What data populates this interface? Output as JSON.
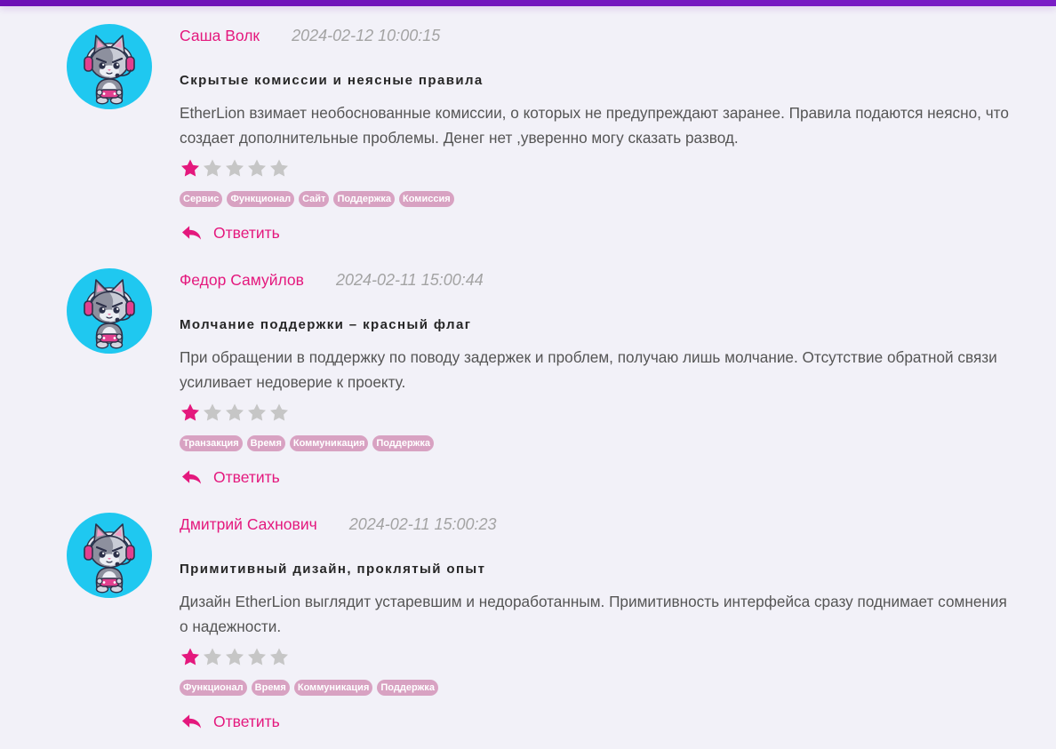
{
  "colors": {
    "top_bar": "#6c0fb5",
    "background": "#f2f1f8",
    "accent": "#e4187d",
    "star_empty": "#c6c6c6",
    "tag_background": "#d8a2c2",
    "date_text": "#a3a3a3"
  },
  "icons": {
    "avatar": "cat-gamer-avatar",
    "star": "star",
    "reply": "reply-arrow"
  },
  "reviews": [
    {
      "author": "Саша Волк",
      "date": "2024-02-12 10:00:15",
      "title": "Скрытые комиссии и неясные правила",
      "body_lines": [
        "EtherLion взимает необоснованные комиссии, о которых не предупреждают заранее. Правила подаются неясно, что",
        "создает дополнительные проблемы. Денег нет ,уверенно могу сказать развод."
      ],
      "rating": 1,
      "rating_max": 5,
      "tags": [
        "Сервис",
        "Функционал",
        "Сайт",
        "Поддержка",
        "Комиссия"
      ],
      "reply_label": "Ответить"
    },
    {
      "author": "Федор Самуйлов",
      "date": "2024-02-11 15:00:44",
      "title": "Молчание поддержки – красный флаг",
      "body_lines": [
        "При обращении в поддержку по поводу задержек и проблем, получаю лишь молчание. Отсутствие обратной связи",
        "усиливает недоверие к проекту."
      ],
      "rating": 1,
      "rating_max": 5,
      "tags": [
        "Транзакция",
        "Время",
        "Коммуникация",
        "Поддержка"
      ],
      "reply_label": "Ответить"
    },
    {
      "author": "Дмитрий Сахнович",
      "date": "2024-02-11 15:00:23",
      "title": "Примитивный дизайн, проклятый опыт",
      "body_lines": [
        "Дизайн EtherLion выглядит устаревшим и недоработанным. Примитивность интерфейса сразу поднимает сомнения",
        "о надежности."
      ],
      "rating": 1,
      "rating_max": 5,
      "tags": [
        "Функционал",
        "Время",
        "Коммуникация",
        "Поддержка"
      ],
      "reply_label": "Ответить"
    }
  ]
}
